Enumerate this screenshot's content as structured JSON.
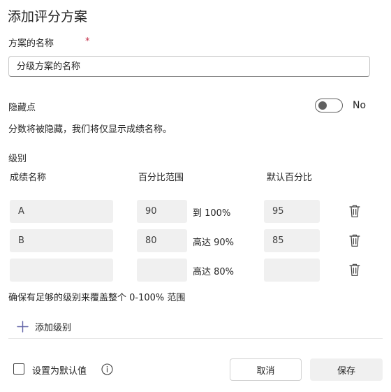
{
  "dialog": {
    "title": "添加评分方案"
  },
  "scheme_name": {
    "label": "方案的名称",
    "required_mark": "*",
    "placeholder": "分级方案的名称"
  },
  "hide_points": {
    "label": "隐藏点",
    "toggle_state": "No",
    "toggle_on": false,
    "description": "分数将被隐藏，我们将仅显示成绩名称。"
  },
  "levels": {
    "label": "级别",
    "headers": {
      "name": "成绩名称",
      "range": "百分比范围",
      "default": "默认百分比"
    },
    "rows": [
      {
        "name": "A",
        "percent": "90",
        "range_text": "到 100%",
        "default": "95"
      },
      {
        "name": "B",
        "percent": "80",
        "range_text": "高达 90%",
        "default": "85"
      },
      {
        "name": "",
        "percent": "",
        "range_text": "高达 80%",
        "default": ""
      }
    ],
    "coverage_note": "确保有足够的级别来覆盖整个 0-100% 范围",
    "add_label": "添加级别"
  },
  "footer": {
    "set_default_label": "设置为默认值",
    "set_default_checked": false,
    "cancel_label": "取消",
    "save_label": "保存"
  },
  "colors": {
    "accent": "#6264a7",
    "required": "#c4314b",
    "field_bg": "#f0f0f0"
  },
  "icons": {
    "delete": "trash-icon",
    "add": "plus-icon",
    "info": "info-icon"
  }
}
